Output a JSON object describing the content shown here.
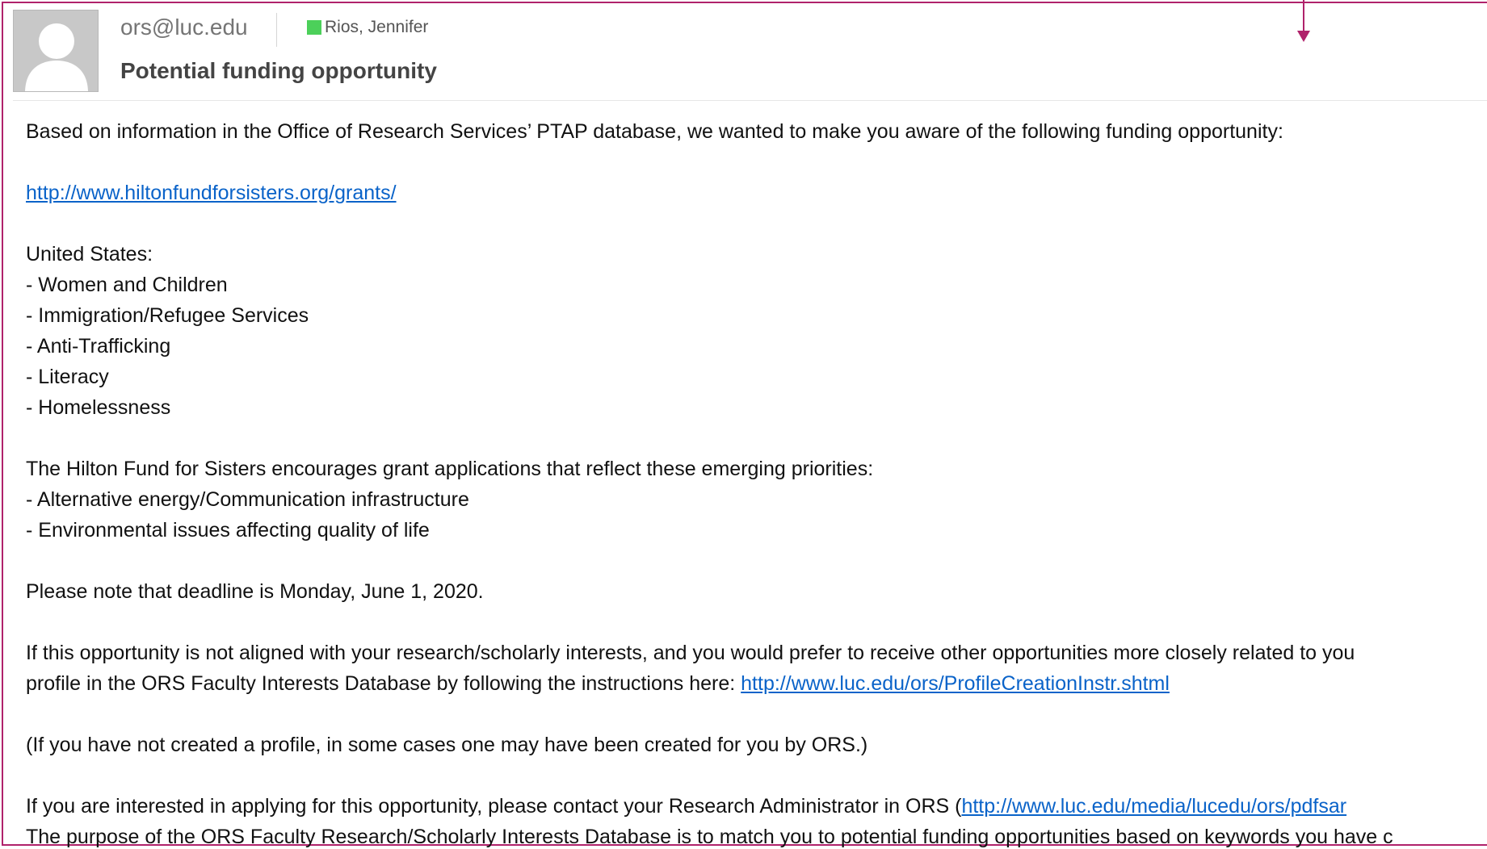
{
  "header": {
    "from": "ors@luc.edu",
    "to_name": "Rios, Jennifer",
    "presence_color": "#4cd05a",
    "subject": "Potential funding opportunity"
  },
  "body": {
    "intro": "Based on information in the Office of Research Services’ PTAP database, we wanted to make you aware of the following funding opportunity:",
    "grant_link": "http://www.hiltonfundforsisters.org/grants/",
    "us_heading": "United States:",
    "us_items": [
      "- Women and Children",
      "- Immigration/Refugee Services",
      "- Anti-Trafficking",
      "- Literacy",
      "- Homelessness"
    ],
    "priorities_heading": "The Hilton Fund for Sisters encourages grant applications that reflect these emerging priorities:",
    "priority_items": [
      "- Alternative energy/Communication infrastructure",
      "- Environmental issues affecting quality of life"
    ],
    "deadline": "Please note that deadline is Monday, June 1, 2020.",
    "profile_line1": "If this opportunity is not aligned with your research/scholarly interests, and you would prefer to receive other opportunities more closely related to you",
    "profile_line2_prefix": "profile in the ORS Faculty Interests Database by following the instructions here: ",
    "profile_link": "http://www.luc.edu/ors/ProfileCreationInstr.shtml",
    "profile_note": "(If you have not created a profile, in some cases one may have been created for you by ORS.)",
    "apply_prefix": "If you are interested in applying for this opportunity, please contact your Research Administrator in ORS (",
    "apply_link": "http://www.luc.edu/media/lucedu/ors/pdfsar",
    "purpose": "The purpose of the ORS Faculty Research/Scholarly Interests Database is to match you to potential funding opportunities based on keywords you have c"
  }
}
